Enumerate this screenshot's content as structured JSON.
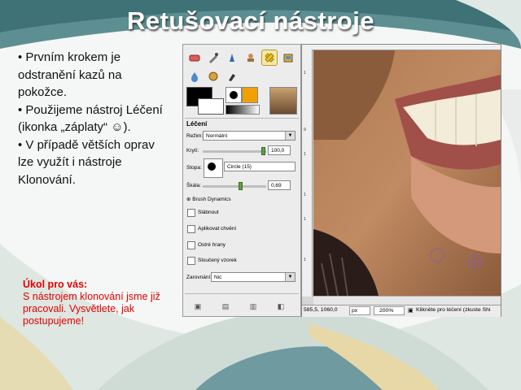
{
  "slide": {
    "title": "Retušovací nástroje",
    "bullets": [
      "• Prvním krokem je odstranění kazů na pokožce.",
      "• Použijeme nástroj Léčení",
      "(ikonka „záplaty“ ☺).",
      "• V případě větších oprav lze využít i nástroje Klonování."
    ],
    "task_heading": "Úkol pro vás:",
    "task_text": "S nástrojem klonování jsme již pracovali. Vysvětlete, jak postupujeme!"
  },
  "gimp": {
    "tool_options_title": "Léčení",
    "mode_label": "Režim:",
    "mode_value": "Normální",
    "opacity_label": "Krytí:",
    "opacity_value": "100,0",
    "opacity_fraction": 1.0,
    "brush_label": "Stopa:",
    "brush_value": "Circle (15)",
    "scale_label": "Škála:",
    "scale_value": "0,69",
    "brush_dynamics_label": "Brush Dynamics",
    "checkboxes": [
      "Slábnout",
      "Aplikovat chvění",
      "Ostré hrany",
      "Sloučený vzorek"
    ],
    "align_label": "Zarovnání:",
    "align_value": "Nic",
    "ruler_marks": [
      "1",
      "9",
      "1",
      "1",
      "1",
      "1"
    ],
    "status": {
      "coords": "585,5, 1060,0",
      "unit": "px",
      "zoom": "200%",
      "message": "Klikněte pro léčení (zkuste Shi"
    }
  },
  "colors": {
    "title": "#ffffff",
    "task": "#e10000",
    "accent_teal": "#3f7f86"
  }
}
